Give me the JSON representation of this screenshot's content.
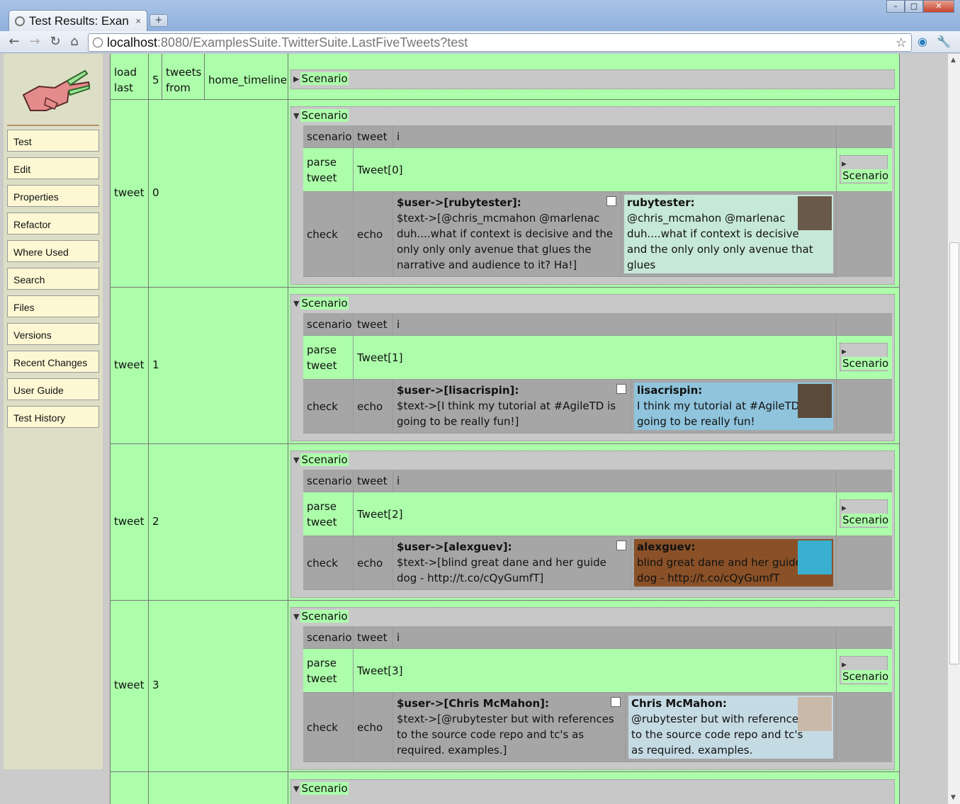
{
  "browser": {
    "tab_title": "Test Results: Exan",
    "tab_close": "×",
    "new_tab": "+",
    "url_host": "localhost",
    "url_rest": ":8080/ExamplesSuite.TwitterSuite.LastFiveTweets?test",
    "back_icon": "back-arrow-icon",
    "forward_icon": "forward-arrow-icon",
    "reload_icon": "reload-icon",
    "home_icon": "home-icon",
    "star_icon": "bookmark-star-icon",
    "wrench_icon": "wrench-icon"
  },
  "sidebar": {
    "items": [
      {
        "label": "Test"
      },
      {
        "label": "Edit"
      },
      {
        "label": "Properties"
      },
      {
        "label": "Refactor"
      },
      {
        "label": "Where Used"
      },
      {
        "label": "Search"
      },
      {
        "label": "Files"
      },
      {
        "label": "Versions"
      },
      {
        "label": "Recent Changes"
      },
      {
        "label": "User Guide"
      },
      {
        "label": "Test History"
      }
    ]
  },
  "table": {
    "first_row": {
      "c1a": "load",
      "c1b": "last",
      "c2": "5",
      "c3a": "tweets",
      "c3b": "from",
      "c4": "home_timeline",
      "scenario": "Scenario"
    },
    "scenario_label": "Scenario",
    "header": {
      "h1": "scenario",
      "h2": "tweet",
      "h3": "i"
    },
    "parse_a": "parse",
    "parse_b": "tweet",
    "check": "check",
    "echo": "echo",
    "rows": [
      {
        "label": "tweet",
        "index": "0",
        "tweet_fn": "Tweet[0]",
        "user_line": "$user->[rubytester]:",
        "text_lines": [
          "$text->[@chris_mcmahon @marlenac",
          "duh....what if context is decisive and the",
          "only only only avenue that glues the",
          "narrative and audience to it? Ha!]"
        ],
        "name": "rubytester:",
        "tweet_lines": [
          "@chris_mcmahon @marlenac",
          "duh....what if context is decisive",
          "and the only only only avenue that glues",
          "the narrative and audience to it? Ha!"
        ],
        "bg": "#c6e8d8"
      },
      {
        "label": "tweet",
        "index": "1",
        "tweet_fn": "Tweet[1]",
        "user_line": "$user->[lisacrispin]:",
        "text_lines": [
          "$text->[I think my tutorial at #AgileTD is",
          "going to be really fun!]"
        ],
        "name": "lisacrispin:",
        "tweet_lines": [
          "I think my tutorial at #AgileTD is",
          "going to be really fun!"
        ],
        "bg": "#8fc4dc"
      },
      {
        "label": "tweet",
        "index": "2",
        "tweet_fn": "Tweet[2]",
        "user_line": "$user->[alexguev]:",
        "text_lines": [
          "$text->[blind great dane and her guide",
          "dog - http://t.co/cQyGumfT]"
        ],
        "name": "alexguev:",
        "tweet_lines": [
          "blind great dane and her guide",
          "dog - http://t.co/cQyGumfT"
        ],
        "bg": "#8a5128"
      },
      {
        "label": "tweet",
        "index": "3",
        "tweet_fn": "Tweet[3]",
        "user_line": "$user->[Chris McMahon]:",
        "text_lines": [
          "$text->[@rubytester but with references",
          "to the source code repo and tc's as",
          "required. examples.]"
        ],
        "name": "Chris McMahon:",
        "tweet_lines": [
          "@rubytester but with references",
          "to the source code repo and tc's",
          "as required. examples."
        ],
        "bg": "#c5dbe4"
      }
    ]
  }
}
